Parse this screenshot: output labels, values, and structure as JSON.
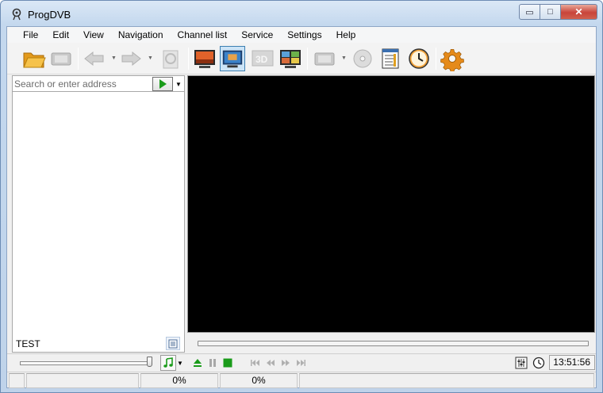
{
  "window": {
    "title": "ProgDVB",
    "min_glyph": "▭",
    "max_glyph": "□",
    "close_glyph": "✕"
  },
  "menu": [
    "File",
    "Edit",
    "View",
    "Navigation",
    "Channel list",
    "Service",
    "Settings",
    "Help"
  ],
  "toolbar": {
    "icons": [
      "open-folder-icon",
      "film-disabled-icon",
      "back-arrow-icon",
      "forward-arrow-icon",
      "search-disabled-icon",
      "monitor-icon",
      "monitor-selected-icon",
      "3d-icon",
      "multi-view-icon",
      "film-icon",
      "disc-icon",
      "notepad-icon",
      "clock-icon",
      "gear-icon"
    ],
    "label_3d": "3D"
  },
  "address": {
    "placeholder": "Search or enter address"
  },
  "left_panel": {
    "status_label": "TEST"
  },
  "player": {
    "time": "13:51:56",
    "progress": 0.0,
    "volume": 1.0
  },
  "statusbar": {
    "cells": [
      "",
      "",
      "0%",
      "0%",
      ""
    ]
  },
  "colors": {
    "accent_green": "#1a9b1a",
    "selection_blue": "#cce4f7",
    "video_bg": "#000000"
  }
}
